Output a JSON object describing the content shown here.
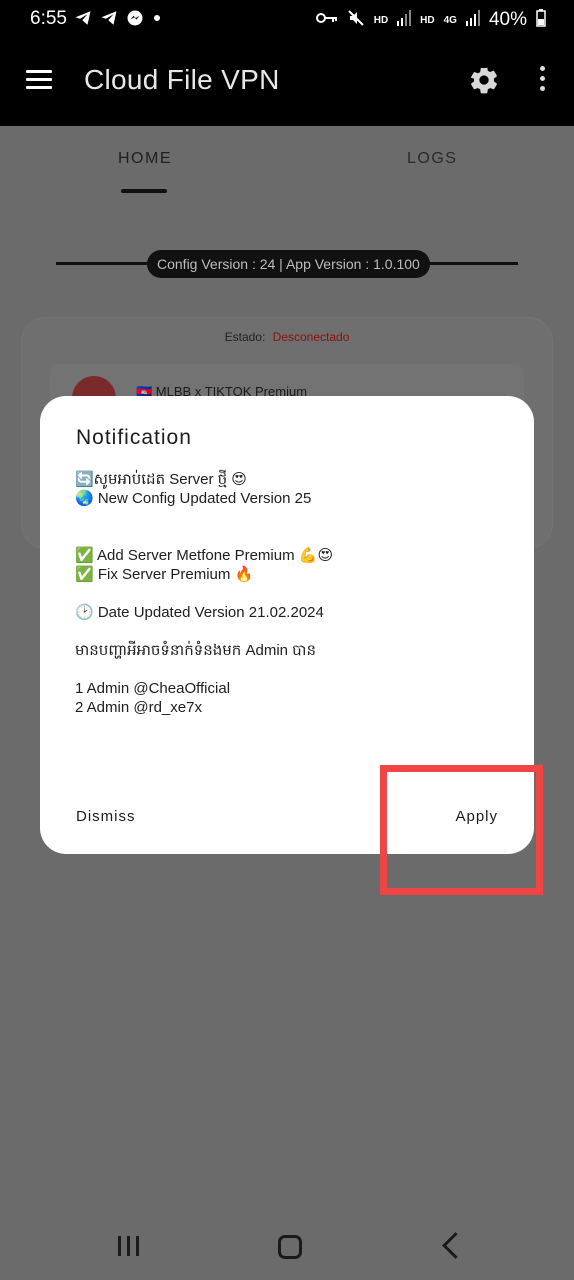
{
  "status_bar": {
    "time": "6:55",
    "left_icons": [
      "telegram-icon",
      "telegram-icon",
      "messenger-icon",
      "dot-icon"
    ],
    "right_icons": [
      "vpn-key-icon",
      "mute-icon",
      "hd-signal-icon",
      "hd-4g-signal-icon"
    ],
    "hd1": "HD",
    "hd2": "HD",
    "network": "4G",
    "battery": "40%"
  },
  "app_bar": {
    "title": "Cloud File VPN"
  },
  "tabs": [
    {
      "label": "HOME",
      "selected": true
    },
    {
      "label": "LOGS",
      "selected": false
    }
  ],
  "version_info": "Config Version : 24 | App Version : 1.0.100",
  "status": {
    "label": "Estado:",
    "value": "Desconectado"
  },
  "server": {
    "name": "🇰🇭 MLBB x TIKTOK Premium"
  },
  "dialog": {
    "title": "Notification",
    "lines": {
      "l1": "🔄សូមអាប់ដេត Server ថ្មី 😍",
      "l2": "🌏 New Config Updated Version 25",
      "l3": "✅ Add Server Metfone Premium 💪😍",
      "l4": "✅ Fix Server Premium 🔥",
      "l5": "🕑 Date Updated Version 21.02.2024",
      "l6": "មានបញ្ហាអីអាចទំនាក់ទំនងមក Admin បាន",
      "l7": "1 Admin  @CheaOfficial",
      "l8": "2 Admin  @rd_xe7x"
    },
    "dismiss_label": "Dismiss",
    "apply_label": "Apply"
  },
  "colors": {
    "highlight": "#f04545",
    "status_disconnected": "#8a1010"
  }
}
